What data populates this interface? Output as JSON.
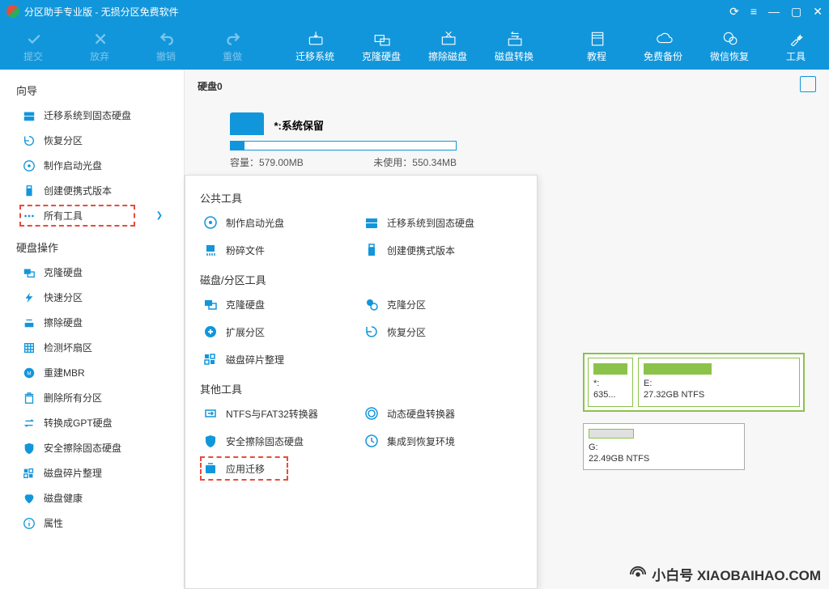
{
  "title": "分区助手专业版 - 无损分区免费软件",
  "toolbar": [
    {
      "label": "提交",
      "icon": "check",
      "disabled": true
    },
    {
      "label": "放弃",
      "icon": "x",
      "disabled": true
    },
    {
      "label": "撤销",
      "icon": "undo",
      "disabled": true
    },
    {
      "label": "重做",
      "icon": "redo",
      "disabled": true
    },
    {
      "label": "迁移系统",
      "icon": "hdd-arrow",
      "disabled": false
    },
    {
      "label": "克隆硬盘",
      "icon": "hdd-copy",
      "disabled": false
    },
    {
      "label": "擦除磁盘",
      "icon": "hdd-x",
      "disabled": false
    },
    {
      "label": "磁盘转换",
      "icon": "hdd-swap",
      "disabled": false
    },
    {
      "label": "教程",
      "icon": "book",
      "disabled": false
    },
    {
      "label": "免费备份",
      "icon": "cloud",
      "disabled": false
    },
    {
      "label": "微信恢复",
      "icon": "wechat",
      "disabled": false
    },
    {
      "label": "工具",
      "icon": "wrench",
      "disabled": false
    }
  ],
  "sidebar": {
    "sec1": "向导",
    "items1": [
      {
        "label": "迁移系统到固态硬盘",
        "icon": "hdd"
      },
      {
        "label": "恢复分区",
        "icon": "recover"
      },
      {
        "label": "制作启动光盘",
        "icon": "disc"
      },
      {
        "label": "创建便携式版本",
        "icon": "usb"
      },
      {
        "label": "所有工具",
        "icon": "dots",
        "hl": true
      }
    ],
    "sec2": "硬盘操作",
    "items2": [
      {
        "label": "克隆硬盘",
        "icon": "clone"
      },
      {
        "label": "快速分区",
        "icon": "bolt"
      },
      {
        "label": "擦除硬盘",
        "icon": "erase"
      },
      {
        "label": "检测坏扇区",
        "icon": "grid"
      },
      {
        "label": "重建MBR",
        "icon": "mbr"
      },
      {
        "label": "删除所有分区",
        "icon": "del"
      },
      {
        "label": "转换成GPT硬盘",
        "icon": "swap"
      },
      {
        "label": "安全擦除固态硬盘",
        "icon": "shield"
      },
      {
        "label": "磁盘碎片整理",
        "icon": "defrag"
      },
      {
        "label": "磁盘健康",
        "icon": "health"
      },
      {
        "label": "属性",
        "icon": "info"
      }
    ]
  },
  "disk": {
    "title": "硬盘0",
    "partition": {
      "name": "*:系统保留",
      "capacity_label": "容量：",
      "capacity": "579.00MB",
      "unused_label": "未使用：",
      "unused": "550.34MB"
    }
  },
  "popup": {
    "sec1": "公共工具",
    "row1": [
      {
        "label": "制作启动光盘",
        "icon": "disc"
      },
      {
        "label": "迁移系统到固态硬盘",
        "icon": "hdd"
      }
    ],
    "row2": [
      {
        "label": "粉碎文件",
        "icon": "shred"
      },
      {
        "label": "创建便携式版本",
        "icon": "usb"
      }
    ],
    "sec2": "磁盘/分区工具",
    "row3": [
      {
        "label": "克隆硬盘",
        "icon": "clone"
      },
      {
        "label": "克隆分区",
        "icon": "clonep"
      }
    ],
    "row4": [
      {
        "label": "扩展分区",
        "icon": "expand"
      },
      {
        "label": "恢复分区",
        "icon": "recover"
      }
    ],
    "row5": [
      {
        "label": "磁盘碎片整理",
        "icon": "defrag"
      }
    ],
    "sec3": "其他工具",
    "row6": [
      {
        "label": "NTFS与FAT32转换器",
        "icon": "convert"
      },
      {
        "label": "动态硬盘转换器",
        "icon": "dyn"
      }
    ],
    "row7": [
      {
        "label": "安全擦除固态硬盘",
        "icon": "shield"
      },
      {
        "label": "集成到恢复环境",
        "icon": "integrate"
      }
    ],
    "row8": [
      {
        "label": "应用迁移",
        "icon": "app",
        "hl": true
      }
    ]
  },
  "part_boxes": {
    "r1": [
      {
        "drive": "*:",
        "size": "635..."
      },
      {
        "drive": "E:",
        "size": "27.32GB NTFS"
      }
    ],
    "r2": [
      {
        "drive": "G:",
        "size": "22.49GB NTFS"
      }
    ]
  },
  "watermark": "小白号 XIAOBAIHAO.COM"
}
